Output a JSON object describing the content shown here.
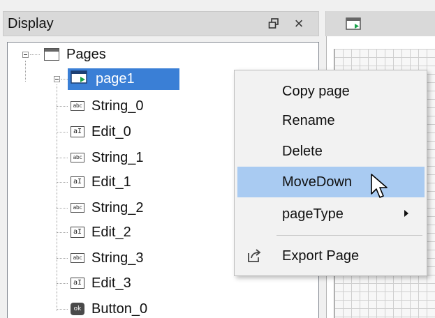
{
  "panel": {
    "title": "Display"
  },
  "tree": {
    "root": {
      "label": "Pages",
      "icon": "pages-icon"
    },
    "page": {
      "label": "page1",
      "icon": "page-icon",
      "selected": true
    },
    "children": [
      {
        "label": "String_0",
        "type": "string"
      },
      {
        "label": "Edit_0",
        "type": "edit"
      },
      {
        "label": "String_1",
        "type": "string"
      },
      {
        "label": "Edit_1",
        "type": "edit"
      },
      {
        "label": "String_2",
        "type": "string"
      },
      {
        "label": "Edit_2",
        "type": "edit"
      },
      {
        "label": "String_3",
        "type": "string"
      },
      {
        "label": "Edit_3",
        "type": "edit"
      },
      {
        "label": "Button_0",
        "type": "button"
      }
    ]
  },
  "context_menu": {
    "items": [
      {
        "label": "Copy page"
      },
      {
        "label": "Rename"
      },
      {
        "label": "Delete"
      },
      {
        "label": "MoveDown",
        "highlighted": true
      },
      {
        "label": "pageType",
        "submenu": true
      },
      {
        "label": "Export Page",
        "icon": "export-icon"
      }
    ]
  },
  "icons": {
    "string": "abc",
    "edit": "aI",
    "button": "ok"
  },
  "colors": {
    "selection": "#3a7fd6",
    "menu_highlight": "#a9cbf2"
  }
}
